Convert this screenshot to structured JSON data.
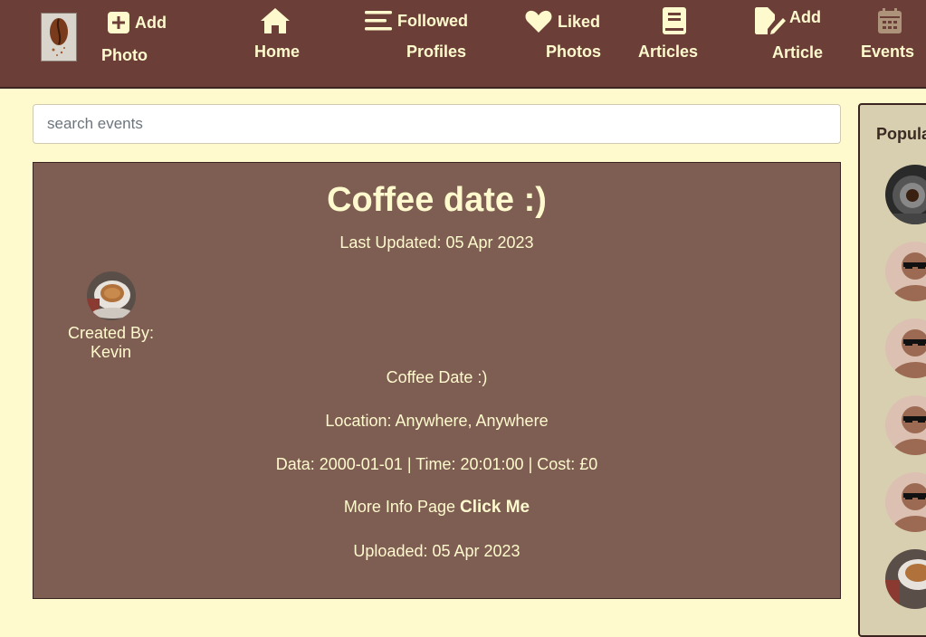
{
  "nav": {
    "add_photo": {
      "line1": "Add",
      "line2": "Photo"
    },
    "home": {
      "label": "Home"
    },
    "followed_profiles": {
      "line1": "Followed",
      "line2": "Profiles"
    },
    "liked_photos": {
      "line1": "Liked",
      "line2": "Photos"
    },
    "articles": {
      "label": "Articles"
    },
    "add_article": {
      "line1": "Add",
      "line2": "Article"
    },
    "events": {
      "label": "Events"
    }
  },
  "search": {
    "placeholder": "search events"
  },
  "event": {
    "title": "Coffee date :)",
    "last_updated": "Last Updated: 05 Apr 2023",
    "created_by": "Created By: Kevin",
    "description": "Coffee Date :)",
    "location": "Location: Anywhere, Anywhere",
    "details": "Data: 2000-01-01 | Time: 20:01:00 | Cost: £0",
    "more_info_text": "More Info Page",
    "more_info_link": "Click Me",
    "uploaded": "Uploaded: 05 Apr 2023"
  },
  "popular": {
    "title": "Popular Profiles",
    "avatars": [
      "coffee-machine-photo",
      "default-avatar",
      "default-avatar",
      "default-avatar",
      "default-avatar",
      "coffee-cup-photo"
    ]
  },
  "colors": {
    "navbar": "#6b3f38",
    "background": "#fffacd",
    "card": "#7e5d52",
    "text_light": "#fffacd",
    "sidebar": "#d8cfb0"
  }
}
